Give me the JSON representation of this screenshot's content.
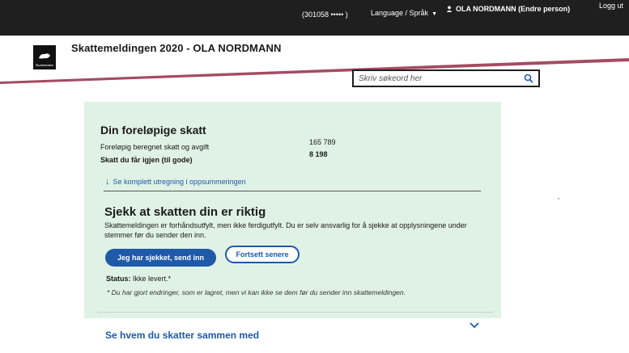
{
  "topbar": {
    "account": "(301058 ••••• )",
    "language": "Language / Språk",
    "user": "OLA NORDMANN (Endre person)",
    "logout": "Logg ut"
  },
  "logo": {
    "text": "Skatteetaten"
  },
  "header": {
    "title": "Skattemeldingen 2020 - OLA NORDMANN"
  },
  "search": {
    "placeholder": "Skriv søkeord her"
  },
  "colors": {
    "accent": "#a54b63",
    "primary": "#1e5aa8",
    "card_bg": "#dff2e5"
  },
  "summary": {
    "heading": "Din foreløpige skatt",
    "row1_label": "Foreløpig beregnet skatt og avgift",
    "row1_value": "165 789",
    "row2_label": "Skatt du får igjen (til gode)",
    "row2_value": "8 198",
    "link": "Se komplett utregning i oppsummeringen"
  },
  "check": {
    "heading": "Sjekk at skatten din er riktig",
    "description": "Skattemeldingen er forhåndsutfylt, men ikke ferdigutfylt. Du er selv ansvarlig for å sjekke at opplysningene under stemmer før du sender den inn.",
    "btn_send": "Jeg har sjekket, send inn",
    "btn_continue": "Fortsett senere",
    "status_label": "Status:",
    "status_value": "Ikke levert.*",
    "note": "* Du har gjort endringer, som er lagret, men vi kan ikke se dem før du sender inn skattemeldingen."
  },
  "accordion": {
    "title": "Se hvem du skatter sammen med"
  },
  "icons": [
    "person-icon",
    "caret-down-icon",
    "logo-icon",
    "search-icon",
    "arrow-down-icon",
    "chevron-down-icon"
  ]
}
